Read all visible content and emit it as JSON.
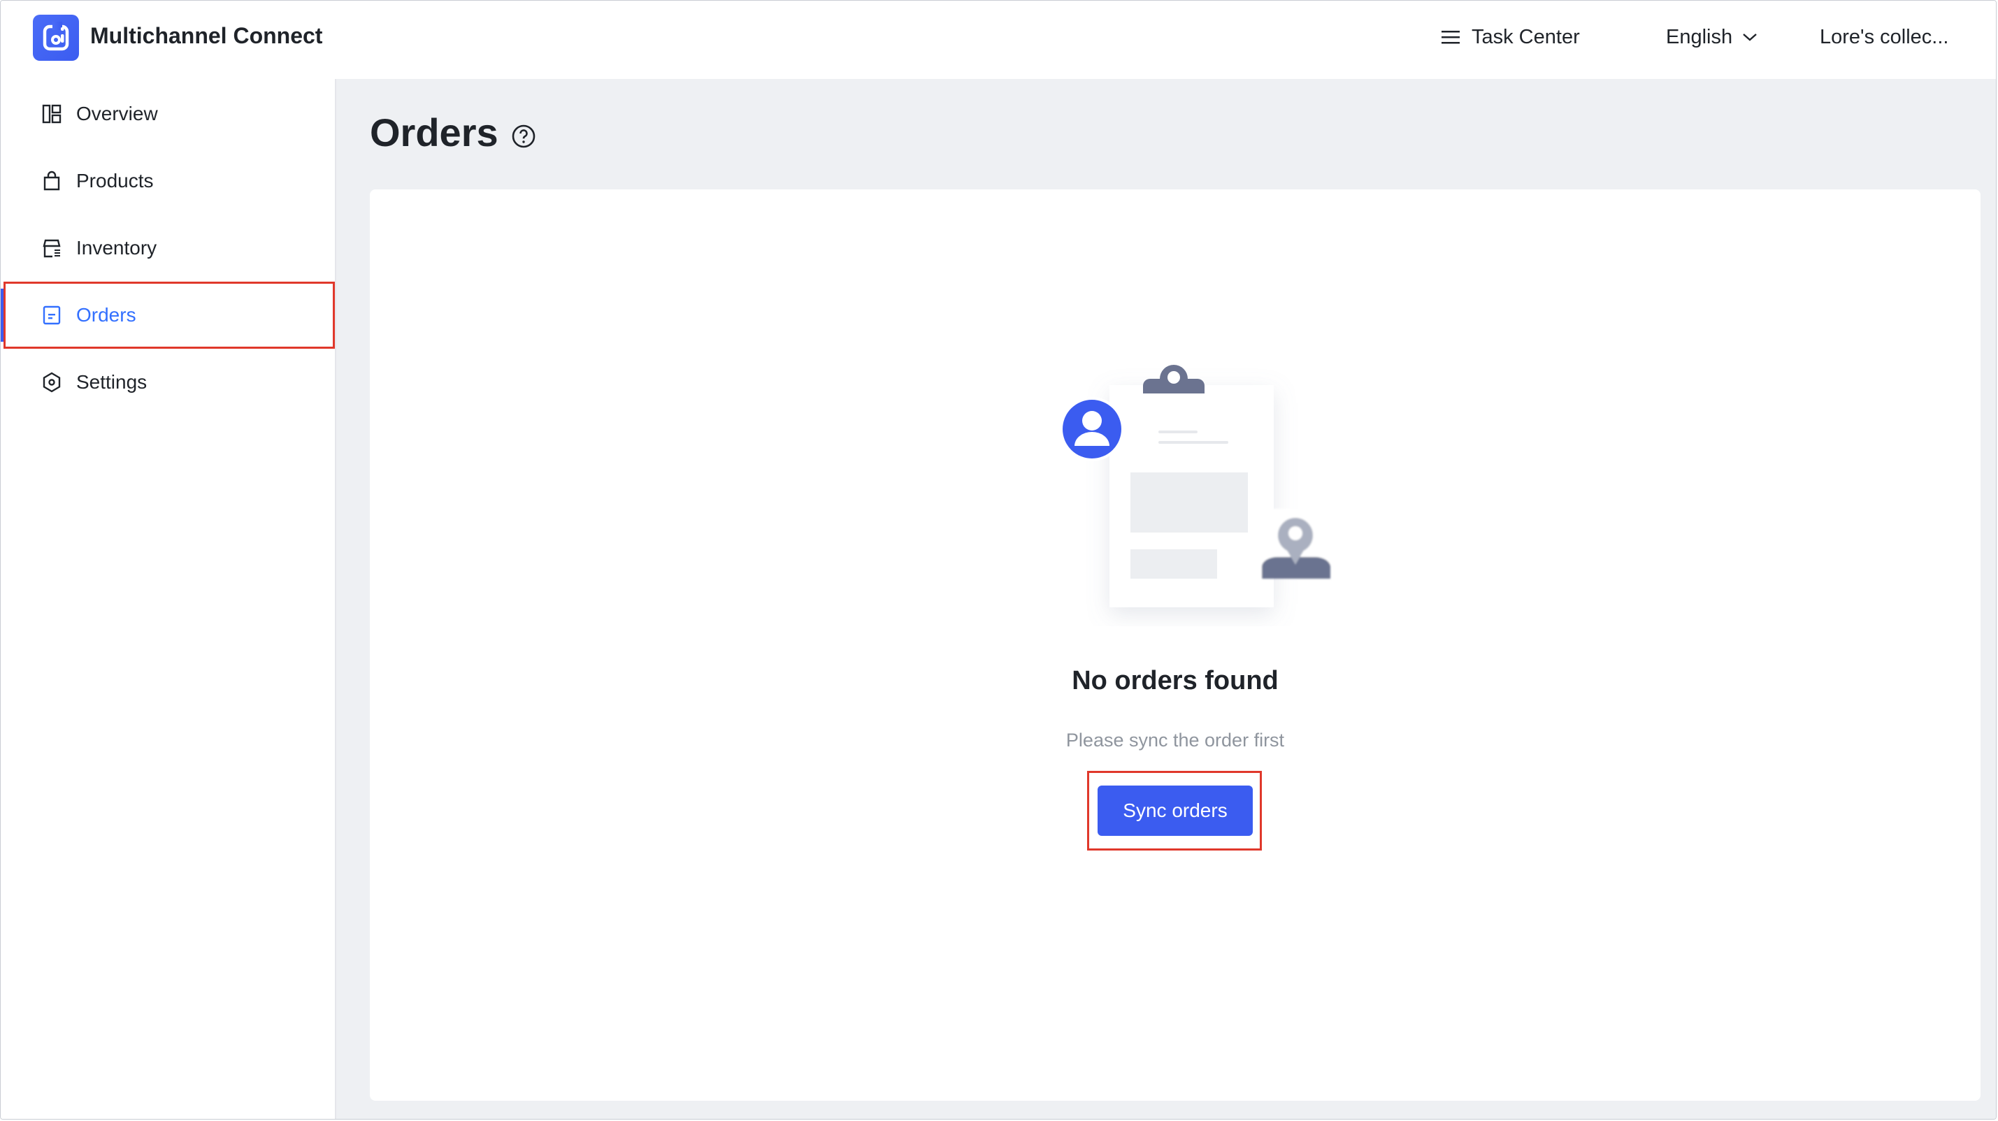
{
  "app": {
    "title": "Multichannel Connect",
    "logo_icon": "app-logo-icon"
  },
  "header": {
    "task_center_label": "Task Center",
    "language_label": "English",
    "account_label": "Lore's collec..."
  },
  "sidebar": {
    "items": [
      {
        "label": "Overview",
        "icon": "overview-icon"
      },
      {
        "label": "Products",
        "icon": "shopping-bag-icon"
      },
      {
        "label": "Inventory",
        "icon": "store-icon"
      },
      {
        "label": "Orders",
        "icon": "orders-icon",
        "active": true
      },
      {
        "label": "Settings",
        "icon": "settings-icon"
      }
    ]
  },
  "page": {
    "title": "Orders",
    "empty_state": {
      "title": "No orders found",
      "subtitle": "Please sync the order first",
      "button_label": "Sync orders"
    }
  },
  "colors": {
    "accent": "#3b5cf0",
    "active_text": "#3370ff",
    "highlight_border": "#e0382b",
    "content_background": "#eef0f3"
  }
}
